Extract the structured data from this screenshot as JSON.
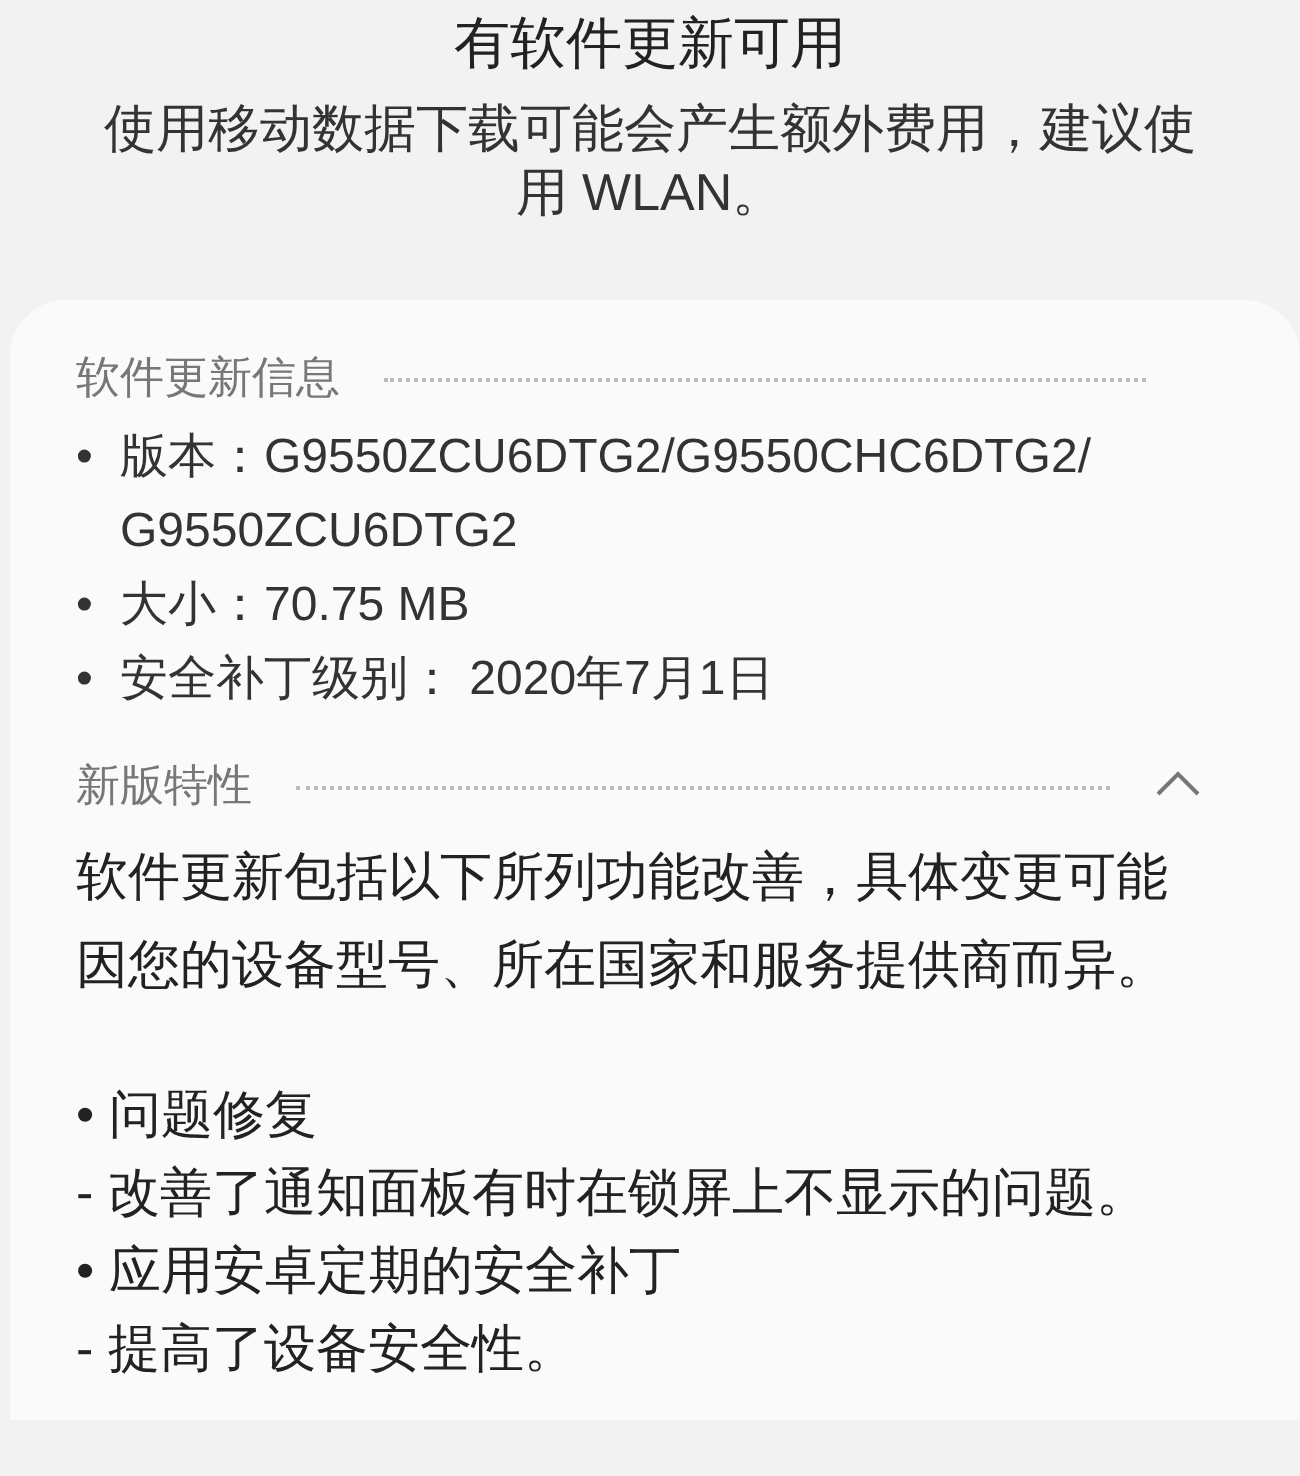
{
  "header": {
    "title": "有软件更新可用",
    "subtitle": "使用移动数据下载可能会产生额外费用，建议使用 WLAN。"
  },
  "sections": [
    {
      "title": "软件更新信息",
      "kind": "info",
      "items": [
        {
          "marker": "•",
          "text": "版本：G9550ZCU6DTG2/G9550CHC6DTG2/G9550ZCU6DTG2"
        },
        {
          "marker": "•",
          "text": "大小：70.75 MB"
        },
        {
          "marker": "•",
          "text": "安全补丁级别： 2020年7月1日"
        }
      ]
    },
    {
      "title": "新版特性",
      "kind": "notes",
      "expanded": true,
      "paragraphs": [
        [
          "软件更新包括以下所列功能改善，具体变更可能因您的设备型号、所在国家和服务提供商而异。"
        ],
        [
          "• 问题修复",
          "- 改善了通知面板有时在锁屏上不显示的问题。",
          "• 应用安卓定期的安全补丁",
          "- 提高了设备安全性。"
        ]
      ]
    }
  ]
}
